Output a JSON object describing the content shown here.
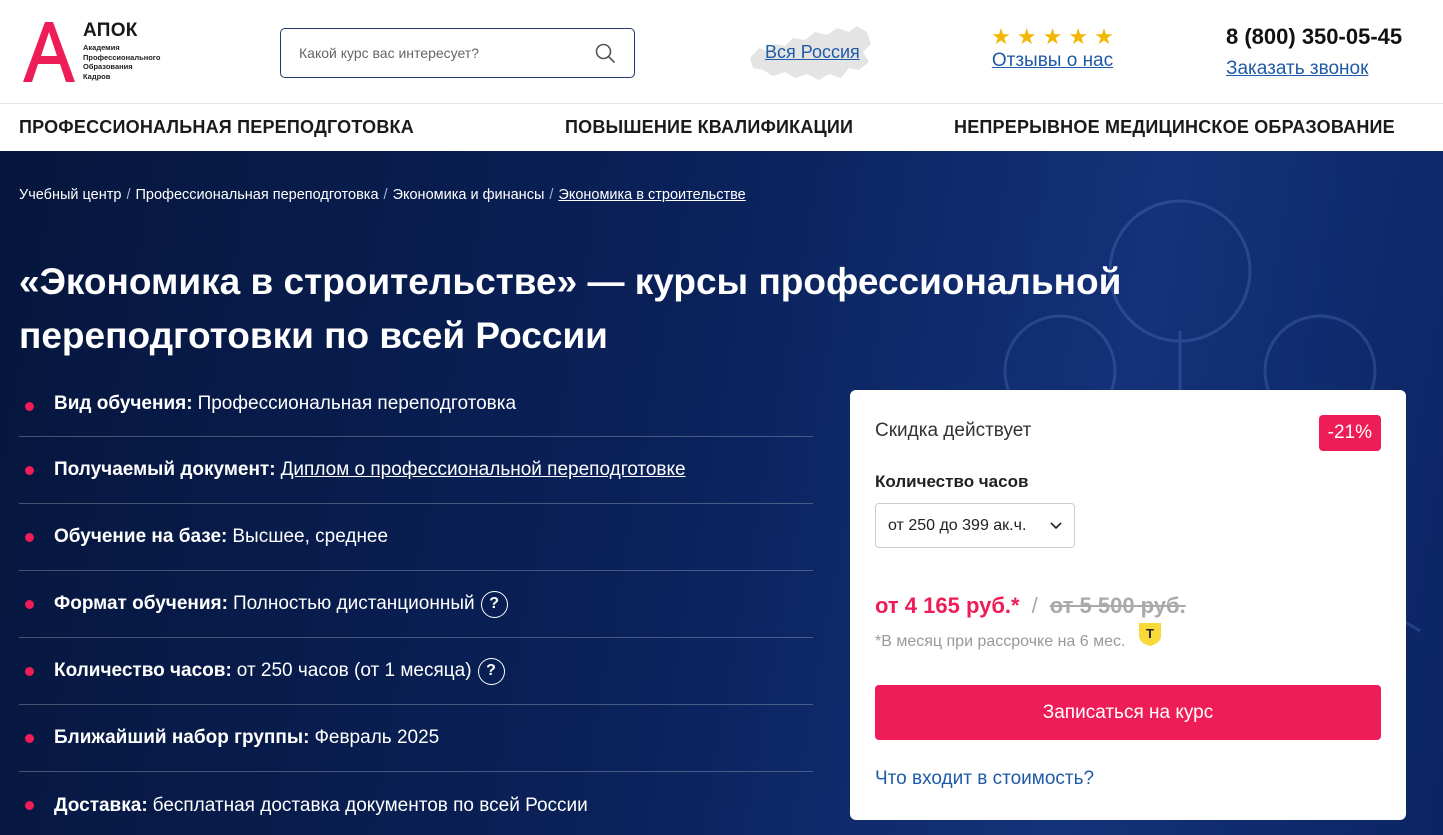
{
  "header": {
    "logo_letter": "А",
    "logo_name": "АПОК",
    "logo_sub": [
      "Академия",
      "Профессионального",
      "Образования",
      "Кадров"
    ],
    "search_placeholder": "Какой курс вас интересует?",
    "region_link": "Вся Россия",
    "rating_stars": 5,
    "reviews_link": "Отзывы о нас",
    "phone": "8 (800) 350-05-45",
    "callback_link": "Заказать звонок"
  },
  "nav": {
    "items": [
      "ПРОФЕССИОНАЛЬНАЯ ПЕРЕПОДГОТОВКА",
      "ПОВЫШЕНИЕ КВАЛИФИКАЦИИ",
      "НЕПРЕРЫВНОЕ МЕДИЦИНСКОЕ ОБРАЗОВАНИЕ"
    ]
  },
  "breadcrumb": {
    "items": [
      "Учебный центр",
      "Профессиональная переподготовка",
      "Экономика и финансы",
      "Экономика в строительстве"
    ],
    "separator": "/"
  },
  "hero": {
    "title_line1": "«Экономика в строительстве» — курсы профессиональной",
    "title_line2": "переподготовки по всей России"
  },
  "features": [
    {
      "label": "Вид обучения:",
      "value": "Профессиональная переподготовка"
    },
    {
      "label": "Получаемый документ:",
      "value": "Диплом о профессиональной переподготовке"
    },
    {
      "label": "Обучение на базе:",
      "value": "Высшее, среднее"
    },
    {
      "label": "Формат обучения:",
      "value": "Полностью дистанционный",
      "help": "?"
    },
    {
      "label": "Количество часов:",
      "value": "от 250 часов (от 1 месяца)",
      "help": "?"
    },
    {
      "label": "Ближайший набор группы:",
      "value": "Февраль 2025"
    },
    {
      "label": "Доставка:",
      "value": "бесплатная доставка документов по всей России"
    }
  ],
  "card": {
    "discount_label": "Скидка действует",
    "discount_badge": "-21%",
    "hours_label": "Количество часов",
    "hours_selected": "от 250 до 399 ак.ч.",
    "price_new": "от 4 165 руб.*",
    "price_separator": "/",
    "price_old": "от 5 500 руб.",
    "installment_note": "*В месяц при рассрочке на 6 мес.",
    "installment_badge": "T",
    "enroll_button": "Записаться на курс",
    "whats_included_link": "Что входит в стоимость?"
  },
  "colors": {
    "accent": "#ee1c57",
    "link": "#1f5aa6",
    "hero_bg": "#0a2159",
    "star": "#f2b705"
  }
}
